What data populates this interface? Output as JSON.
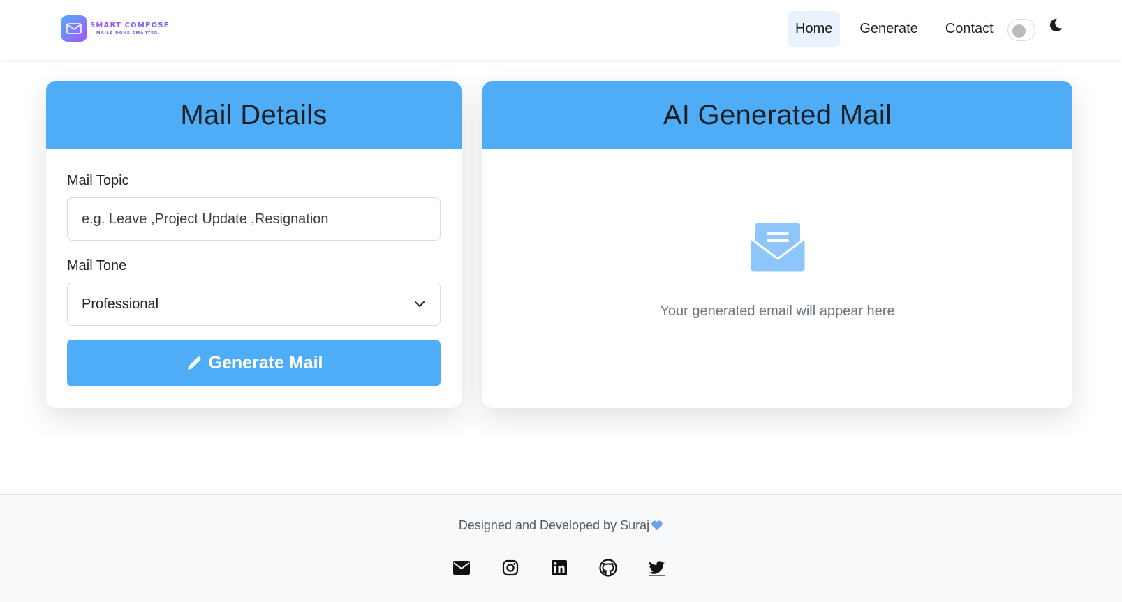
{
  "navbar": {
    "brand_name": "SMART COMPOSE",
    "brand_tagline": "MAILS DONE SMARTER.",
    "links": [
      {
        "label": "Home",
        "active": true
      },
      {
        "label": "Generate",
        "active": false
      },
      {
        "label": "Contact",
        "active": false
      }
    ],
    "theme_toggle": {
      "on": false,
      "icon": "moon-icon"
    }
  },
  "mail_details": {
    "title": "Mail Details",
    "topic_label": "Mail Topic",
    "topic_placeholder": "e.g. Leave ,Project Update ,Resignation",
    "topic_value": "",
    "tone_label": "Mail Tone",
    "tone_selected": "Professional",
    "generate_button": "Generate Mail",
    "generate_icon": "pencil-icon"
  },
  "ai_output": {
    "title": "AI Generated Mail",
    "icon": "envelope-open-text-icon",
    "placeholder_text": "Your generated email will appear here"
  },
  "footer": {
    "credit": "Designed and Developed by Suraj",
    "credit_icon": "blue-heart-icon",
    "socials": [
      "email-icon",
      "instagram-icon",
      "linkedin-icon",
      "github-icon",
      "twitter-icon"
    ]
  },
  "colors": {
    "accent": "#4facf6",
    "icon_light_blue": "#8ec5fa",
    "active_nav_bg": "#e8f3fd"
  }
}
